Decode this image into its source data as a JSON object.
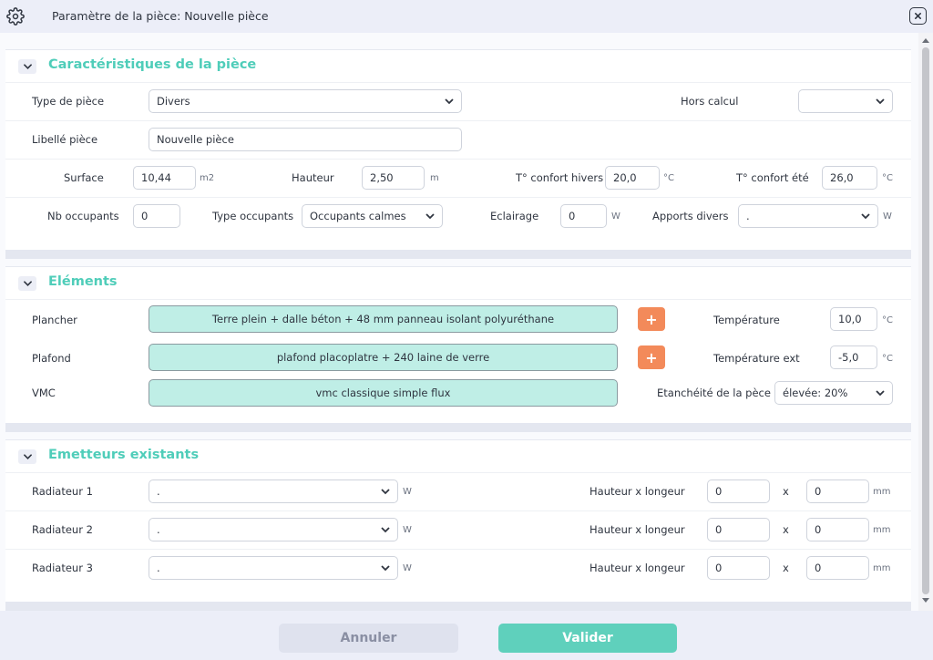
{
  "window": {
    "title": "Paramètre de la pièce: Nouvelle pièce"
  },
  "caracteristiques": {
    "title": "Caractéristiques de la pièce",
    "type_piece_label": "Type de pièce",
    "type_piece_value": "Divers",
    "hors_calcul_label": "Hors calcul",
    "hors_calcul_value": "",
    "libelle_label": "Libellé pièce",
    "libelle_value": "Nouvelle pièce",
    "surface_label": "Surface",
    "surface_value": "10,44",
    "surface_unit": "m2",
    "hauteur_label": "Hauteur",
    "hauteur_value": "2,50",
    "hauteur_unit": "m",
    "tconf_hiver_label": "T° confort hivers",
    "tconf_hiver_value": "20,0",
    "tconf_hiver_unit": "°C",
    "tconf_ete_label": "T° confort été",
    "tconf_ete_value": "26,0",
    "tconf_ete_unit": "°C",
    "nb_occupants_label": "Nb occupants",
    "nb_occupants_value": "0",
    "type_occupants_label": "Type occupants",
    "type_occupants_value": "Occupants calmes",
    "eclairage_label": "Eclairage",
    "eclairage_value": "0",
    "eclairage_unit": "W",
    "apports_label": "Apports divers",
    "apports_value": ".",
    "apports_unit": "W"
  },
  "elements": {
    "title": "Eléments",
    "plancher_label": "Plancher",
    "plancher_value": "Terre plein + dalle béton + 48 mm panneau isolant polyuréthane",
    "plafond_label": "Plafond",
    "plafond_value": "plafond placoplatre + 240 laine de verre",
    "vmc_label": "VMC",
    "vmc_value": "vmc classique simple flux",
    "plus_symbol": "+",
    "temperature_label": "Température",
    "temperature_value": "10,0",
    "temperature_unit": "°C",
    "temp_ext_label": "Température ext",
    "temp_ext_value": "-5,0",
    "temp_ext_unit": "°C",
    "etancheite_label": "Etanchéité de la pèce",
    "etancheite_value": "élevée: 20%"
  },
  "emetteurs": {
    "title": "Emetteurs existants",
    "dim_label": "Hauteur x longeur",
    "x_symbol": "x",
    "power_unit": "W",
    "dim_unit": "mm",
    "radiateurs": [
      {
        "label": "Radiateur 1",
        "value": ".",
        "hauteur": "0",
        "longueur": "0"
      },
      {
        "label": "Radiateur 2",
        "value": ".",
        "hauteur": "0",
        "longueur": "0"
      },
      {
        "label": "Radiateur 3",
        "value": ".",
        "hauteur": "0",
        "longueur": "0"
      }
    ]
  },
  "footer": {
    "cancel_label": "Annuler",
    "ok_label": "Valider"
  }
}
